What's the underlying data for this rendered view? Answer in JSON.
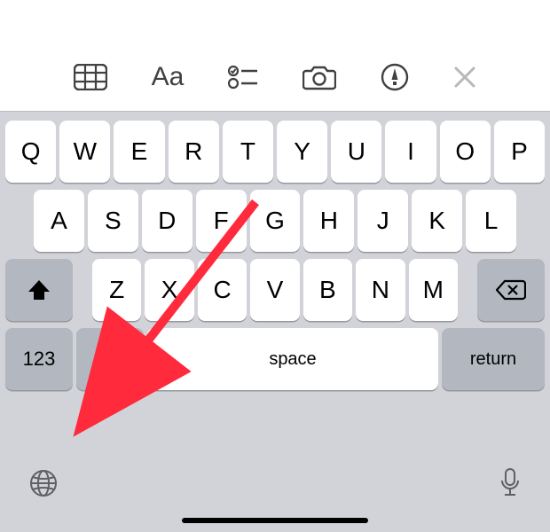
{
  "toolbar": {
    "icons": [
      "table-icon",
      "text-format-icon",
      "checklist-icon",
      "camera-icon",
      "markup-icon",
      "close-icon"
    ]
  },
  "keyboard": {
    "row1": [
      "Q",
      "W",
      "E",
      "R",
      "T",
      "Y",
      "U",
      "I",
      "O",
      "P"
    ],
    "row2": [
      "A",
      "S",
      "D",
      "F",
      "G",
      "H",
      "J",
      "K",
      "L"
    ],
    "row3": [
      "Z",
      "X",
      "C",
      "V",
      "B",
      "N",
      "M"
    ],
    "shift_label": "",
    "backspace_label": "",
    "numbers_label": "123",
    "emoji_label": "",
    "space_label": "space",
    "return_label": "return"
  },
  "annotation": {
    "type": "arrow",
    "points_to": "emoji-key",
    "color": "#ff2a3c"
  }
}
